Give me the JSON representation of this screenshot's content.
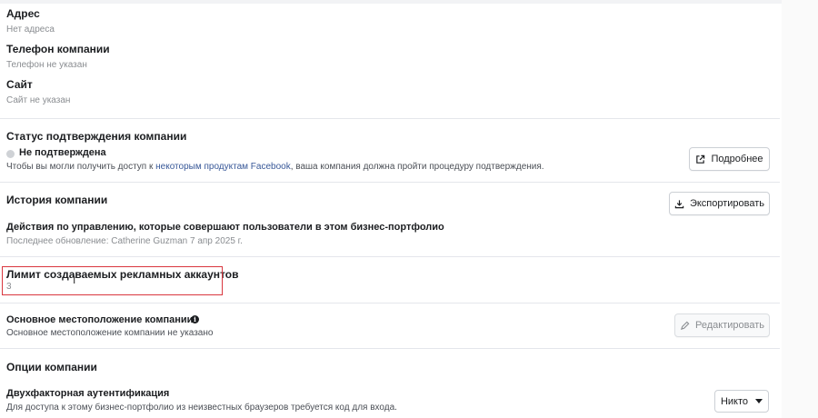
{
  "address": {
    "label": "Адрес",
    "value": "Нет адреса"
  },
  "company_phone": {
    "label": "Телефон компании",
    "value": "Телефон не указан"
  },
  "site": {
    "label": "Сайт",
    "value": "Сайт не указан"
  },
  "verification": {
    "title": "Статус подтверждения компании",
    "status": "Не подтверждена",
    "desc_before": "Чтобы вы могли получить доступ к ",
    "desc_link": "некоторым продуктам Facebook",
    "desc_after": ", ваша компания должна пройти процедуру подтверждения.",
    "more_button": "Подробнее",
    "more_icon": "external-link-icon"
  },
  "history": {
    "title": "История компании",
    "export_button": "Экспортировать",
    "export_icon": "download-icon",
    "actions_title": "Действия по управлению, которые совершают пользователи в этом бизнес-портфолио",
    "last_update": "Последнее обновление: Catherine Guzman 7 апр 2025 г."
  },
  "ad_account_limit": {
    "label": "Лимит создаваемых рекламных аккаунтов",
    "value": "3",
    "highlight_color": "#d9363e"
  },
  "location": {
    "label": "Основное местоположение компании",
    "value": "Основное местоположение компании не указано",
    "edit_button": "Редактировать",
    "edit_icon": "pencil-icon",
    "info_icon": "info-icon"
  },
  "options": {
    "title": "Опции компании"
  },
  "two_factor": {
    "label": "Двухфакторная аутентификация",
    "desc": "Для доступа к этому бизнес-портфолио из неизвестных браузеров требуется код для входа.",
    "selected": "Никто"
  },
  "colors": {
    "link": "#385898",
    "muted_text": "#8a8d91",
    "divider": "#e4e6eb"
  }
}
